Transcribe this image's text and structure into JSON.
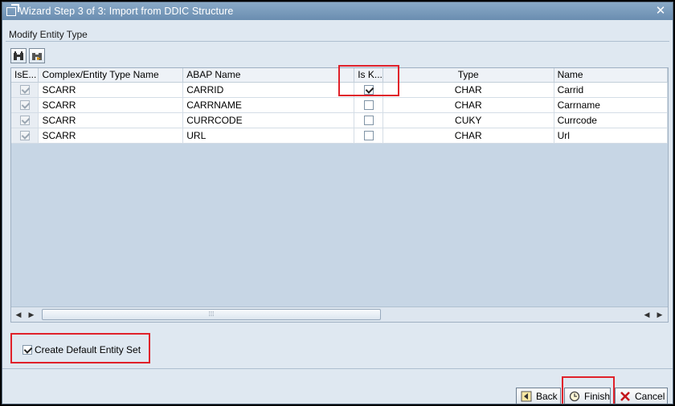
{
  "window": {
    "title": "Wizard Step 3 of 3: Import from DDIC Structure",
    "close_glyph": "✕"
  },
  "section": {
    "label": "Modify Entity Type"
  },
  "toolbar": {
    "buttons": [
      {
        "name": "find-icon"
      },
      {
        "name": "find-next-icon"
      }
    ]
  },
  "table": {
    "columns": [
      "IsE...",
      "Complex/Entity Type Name",
      "ABAP Name",
      "Is K...",
      "Type",
      "Name"
    ],
    "rows": [
      {
        "is_entity": true,
        "entity_name": "SCARR",
        "abap_name": "CARRID",
        "is_key": true,
        "type": "CHAR",
        "name": "Carrid"
      },
      {
        "is_entity": true,
        "entity_name": "SCARR",
        "abap_name": "CARRNAME",
        "is_key": false,
        "type": "CHAR",
        "name": "Carrname"
      },
      {
        "is_entity": true,
        "entity_name": "SCARR",
        "abap_name": "CURRCODE",
        "is_key": false,
        "type": "CUKY",
        "name": "Currcode"
      },
      {
        "is_entity": true,
        "entity_name": "SCARR",
        "abap_name": "URL",
        "is_key": false,
        "type": "CHAR",
        "name": "Url"
      }
    ]
  },
  "scrollbar": {
    "left_arrow": "◀",
    "right_arrow": "▶",
    "grip": "⁞⁞⁞"
  },
  "options": {
    "create_default_entity_set": {
      "label": "Create Default Entity Set",
      "checked": true
    }
  },
  "buttons": {
    "back": "Back",
    "finish": "Finish",
    "cancel": "Cancel"
  },
  "colors": {
    "highlight": "#e0212a",
    "title_bar": "#6a8db0",
    "panel": "#dfe8f1"
  }
}
